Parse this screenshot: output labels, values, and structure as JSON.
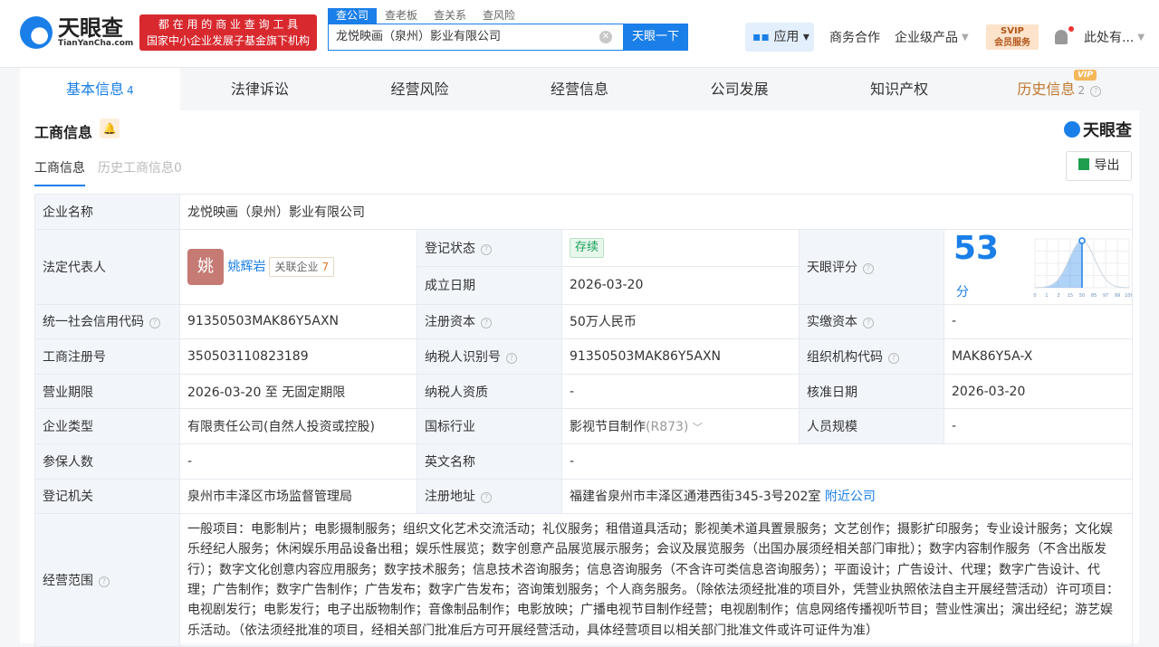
{
  "header": {
    "logo_title": "天眼查",
    "logo_sub": "TianYanCha.com",
    "slogan_1": "都 在 用 的 商 业 查 询 工 具",
    "slogan_2": "国家中小企业发展子基金旗下机构",
    "search_tabs": [
      "查公司",
      "查老板",
      "查关系",
      "查风险"
    ],
    "search_value": "龙悦映画（泉州）影业有限公司",
    "search_button": "天眼一下",
    "nav": {
      "apps": "应用",
      "business": "商务合作",
      "enterprise": "企业级产品",
      "svip_1": "SVIP",
      "svip_2": "会员服务",
      "user": "此处有..."
    }
  },
  "tabs": [
    {
      "label": "基本信息",
      "count": "4"
    },
    {
      "label": "法律诉讼"
    },
    {
      "label": "经营风险"
    },
    {
      "label": "经营信息"
    },
    {
      "label": "公司发展"
    },
    {
      "label": "知识产权"
    },
    {
      "label": "历史信息",
      "count": "2",
      "badge": "VIP"
    }
  ],
  "section": {
    "title": "工商信息",
    "brand": "天眼查",
    "sub_tabs": [
      "工商信息",
      "历史工商信息0"
    ],
    "export": "导出"
  },
  "info": {
    "company_name_label": "企业名称",
    "company_name": "龙悦映画（泉州）影业有限公司",
    "legal_rep_label": "法定代表人",
    "legal_rep_avatar": "姚",
    "legal_rep": "姚辉岩",
    "related_label": "关联企业",
    "related_count": "7",
    "status_label": "登记状态",
    "status": "存续",
    "founded_label": "成立日期",
    "founded": "2026-03-20",
    "rating_label": "天眼评分",
    "rating": "53",
    "rating_unit": "分",
    "credit_code_label": "统一社会信用代码",
    "credit_code": "91350503MAK86Y5AXN",
    "reg_capital_label": "注册资本",
    "reg_capital": "50万人民币",
    "paid_capital_label": "实缴资本",
    "paid_capital": "-",
    "reg_no_label": "工商注册号",
    "reg_no": "350503110823189",
    "tax_id_label": "纳税人识别号",
    "tax_id": "91350503MAK86Y5AXN",
    "org_code_label": "组织机构代码",
    "org_code": "MAK86Y5A-X",
    "term_label": "营业期限",
    "term": "2026-03-20 至 无固定期限",
    "taxpayer_label": "纳税人资质",
    "taxpayer": "-",
    "approved_label": "核准日期",
    "approved": "2026-03-20",
    "type_label": "企业类型",
    "type": "有限责任公司(自然人投资或控股)",
    "industry_label": "国标行业",
    "industry": "影视节目制作",
    "industry_code": "(R873)",
    "staff_label": "人员规模",
    "staff": "-",
    "insured_label": "参保人数",
    "insured": "-",
    "english_label": "英文名称",
    "english": "-",
    "authority_label": "登记机关",
    "authority": "泉州市丰泽区市场监督管理局",
    "address_label": "注册地址",
    "address": "福建省泉州市丰泽区通港西街345-3号202室",
    "nearby": "附近公司",
    "scope_label": "经营范围",
    "scope": "一般项目：电影制片；电影摄制服务；组织文化艺术交流活动；礼仪服务；租借道具活动；影视美术道具置景服务；文艺创作；摄影扩印服务；专业设计服务；文化娱乐经纪人服务；休闲娱乐用品设备出租；娱乐性展览；数字创意产品展览展示服务；会议及展览服务（出国办展须经相关部门审批）；数字内容制作服务（不含出版发行）；数字文化创意内容应用服务；数字技术服务；信息技术咨询服务；信息咨询服务（不含许可类信息咨询服务）；平面设计；广告设计、代理；数字广告设计、代理；广告制作；数字广告制作；广告发布；数字广告发布；咨询策划服务；个人商务服务。（除依法须经批准的项目外，凭营业执照依法自主开展经营活动）许可项目：电视剧发行；电影发行；电子出版物制作；音像制品制作；电影放映；广播电视节目制作经营；电视剧制作；信息网络传播视听节目；营业性演出；演出经纪；游艺娱乐活动。（依法须经批准的项目，经相关部门批准后方可开展经营活动，具体经营项目以相关部门批准文件或许可证件为准）"
  },
  "chart_data": {
    "type": "area",
    "title": "",
    "x_ticks": [
      "0",
      "1",
      "3",
      "15",
      "50",
      "85",
      "97",
      "99",
      "100"
    ],
    "marker_tick": "50",
    "score": 53,
    "accent": "#1a7fe8"
  }
}
